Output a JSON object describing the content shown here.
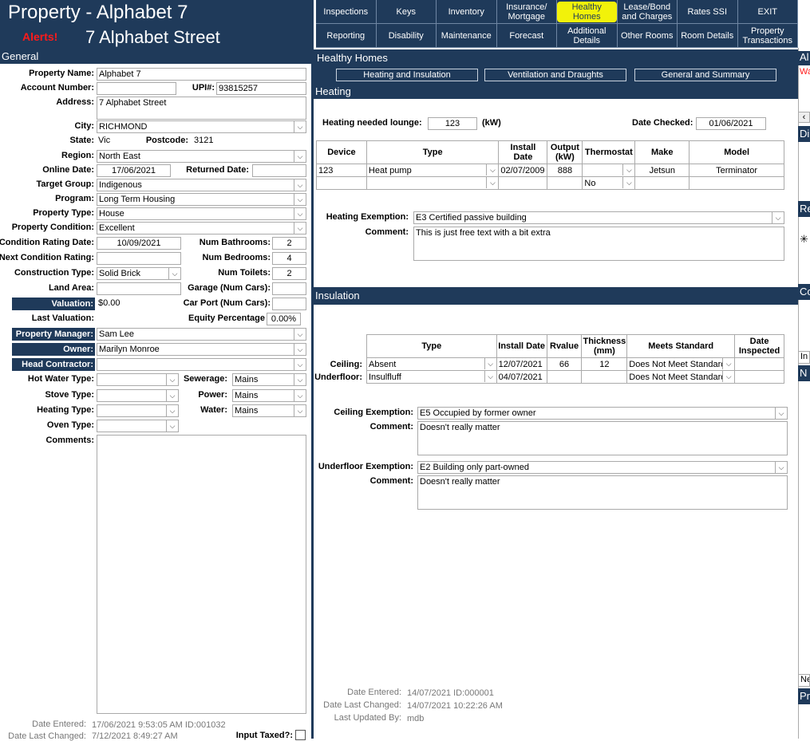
{
  "header": {
    "title": "Property - Alphabet 7",
    "alerts": "Alerts!",
    "street": "7 Alphabet Street"
  },
  "nav": [
    [
      "Inspections",
      "Keys",
      "Inventory",
      "Insurance/ Mortgage",
      "Healthy Homes",
      "Lease/Bond and Charges",
      "Rates SSI",
      "EXIT"
    ],
    [
      "Reporting",
      "Disability",
      "Maintenance",
      "Forecast",
      "Additional Details",
      "Other Rooms",
      "Room Details",
      "Property Transactions"
    ]
  ],
  "general": {
    "section": "General",
    "labels": {
      "property_name": "Property Name:",
      "account_number": "Account Number:",
      "upi": "UPI#:",
      "address": "Address:",
      "city": "City:",
      "state": "State:",
      "postcode": "Postcode:",
      "region": "Region:",
      "online_date": "Online Date:",
      "returned_date": "Returned Date:",
      "target_group": "Target Group:",
      "program": "Program:",
      "property_type": "Property Type:",
      "property_condition": "Property Condition:",
      "condition_rating_date": "Condition Rating Date:",
      "num_bathrooms": "Num Bathrooms:",
      "next_condition_rating": "Next Condition Rating:",
      "num_bedrooms": "Num Bedrooms:",
      "construction_type": "Construction Type:",
      "num_toilets": "Num Toilets:",
      "land_area": "Land Area:",
      "garage": "Garage (Num Cars):",
      "valuation": "Valuation:",
      "car_port": "Car Port (Num Cars):",
      "last_valuation": "Last Valuation:",
      "equity_percentage": "Equity Percentage",
      "property_manager": "Property Manager:",
      "owner": "Owner:",
      "head_contractor": "Head Contractor:",
      "hot_water_type": "Hot Water Type:",
      "sewerage": "Sewerage:",
      "stove_type": "Stove Type:",
      "power": "Power:",
      "heating_type": "Heating Type:",
      "water": "Water:",
      "oven_type": "Oven Type:",
      "comments": "Comments:",
      "date_entered": "Date Entered:",
      "date_last_changed": "Date Last Changed:",
      "input_taxed": "Input Taxed?:"
    },
    "values": {
      "property_name": "Alphabet 7",
      "account_number": "",
      "upi": "93815257",
      "address": "7 Alphabet Street",
      "city": "RICHMOND",
      "state": "Vic",
      "postcode": "3121",
      "region": "North East",
      "online_date": "17/06/2021",
      "returned_date": "",
      "target_group": "Indigenous",
      "program": "Long Term Housing",
      "property_type": "House",
      "property_condition": "Excellent",
      "condition_rating_date": "10/09/2021",
      "num_bathrooms": "2",
      "next_condition_rating": "",
      "num_bedrooms": "4",
      "construction_type": "Solid Brick",
      "num_toilets": "2",
      "land_area": "",
      "garage": "",
      "valuation": "$0.00",
      "car_port": "",
      "last_valuation": "",
      "equity_percentage": "0.00%",
      "property_manager": "Sam Lee",
      "owner": "Marilyn Monroe",
      "head_contractor": "",
      "hot_water_type": "",
      "sewerage": "Mains",
      "stove_type": "",
      "power": "Mains",
      "heating_type": "",
      "water": "Mains",
      "oven_type": "",
      "comments": "",
      "date_entered": "17/06/2021 9:53:05 AM ID:001032",
      "date_last_changed": "7/12/2021 8:49:27 AM"
    }
  },
  "healthy_homes": {
    "section": "Healthy Homes",
    "tabs": [
      "Heating and Insulation",
      "Ventilation and Draughts",
      "General and Summary"
    ],
    "heating": {
      "title": "Heating",
      "needed_label": "Heating needed lounge:",
      "needed_value": "123",
      "unit": "(kW)",
      "date_checked_label": "Date Checked:",
      "date_checked_value": "01/06/2021",
      "columns": [
        "Device",
        "Type",
        "Install Date",
        "Output (kW)",
        "Thermostat",
        "Make",
        "Model"
      ],
      "rows": [
        [
          "123",
          "Heat pump",
          "02/07/2009",
          "888",
          "",
          "Jetsun",
          "Terminator"
        ],
        [
          "",
          "",
          "",
          "",
          "No",
          "",
          ""
        ]
      ],
      "exemption_label": "Heating Exemption:",
      "exemption_value": "E3 Certified passive building",
      "comment_label": "Comment:",
      "comment_value": "This is just free text with a bit extra"
    },
    "insulation": {
      "title": "Insulation",
      "columns": [
        "Type",
        "Install Date",
        "Rvalue",
        "Thickness (mm)",
        "Meets Standard",
        "Date Inspected"
      ],
      "rows": [
        {
          "label": "Ceiling:",
          "type": "Absent",
          "install": "12/07/2021",
          "rvalue": "66",
          "thickness": "12",
          "meets": "Does Not Meet Standard",
          "inspected": ""
        },
        {
          "label": "Underfloor:",
          "type": "Insulfluff",
          "install": "04/07/2021",
          "rvalue": "",
          "thickness": "",
          "meets": "Does Not Meet Standard",
          "inspected": ""
        }
      ],
      "ceiling_exemption_label": "Ceiling Exemption:",
      "ceiling_exemption_value": "E5 Occupied by former owner",
      "ceiling_comment_label": "Comment:",
      "ceiling_comment_value": "Doesn't really matter",
      "underfloor_exemption_label": "Underfloor Exemption:",
      "underfloor_exemption_value": "E2 Building only part-owned",
      "underfloor_comment_label": "Comment:",
      "underfloor_comment_value": "Doesn't really matter"
    },
    "footer": {
      "date_entered_label": "Date Entered:",
      "date_entered_value": "14/07/2021 ID:000001",
      "date_last_changed_label": "Date Last Changed:",
      "date_last_changed_value": "14/07/2021 10:22:26 AM",
      "last_updated_label": "Last Updated By:",
      "last_updated_value": "mdb"
    }
  },
  "right_strip": {
    "a": "Al",
    "b": "Wa",
    "c": "Di",
    "d": "Re",
    "e": "Co",
    "f": "In",
    "g": "N",
    "h": "Ne",
    "i": "Pr"
  },
  "colors": {
    "navy": "#1f3a5a",
    "alert": "#ff1a1a",
    "highlight": "#f2f20a"
  }
}
